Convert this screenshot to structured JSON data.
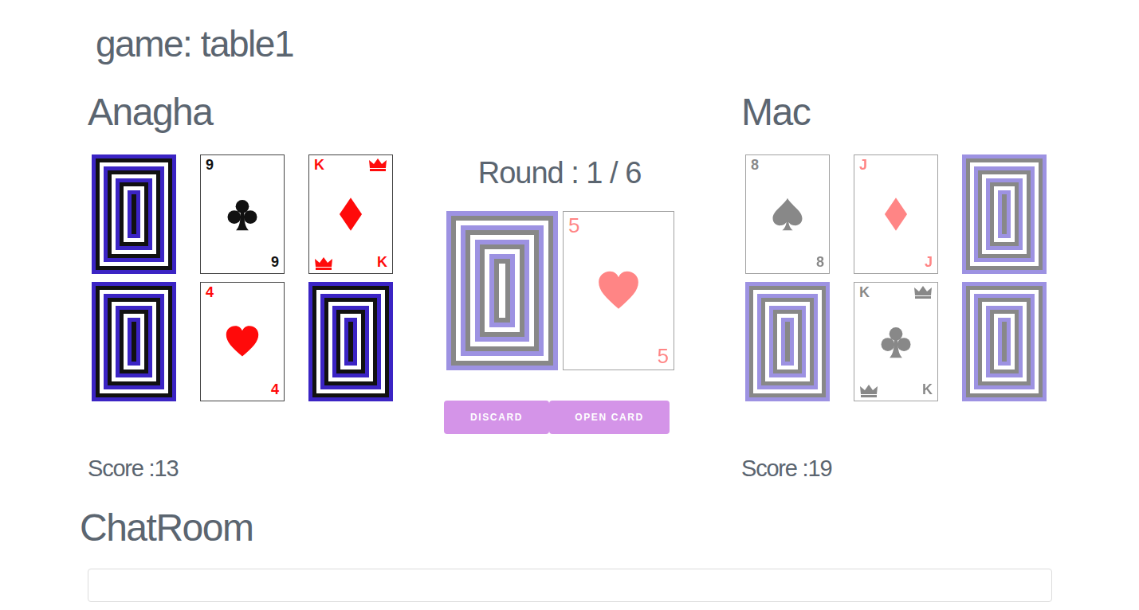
{
  "title": "game: table1",
  "round": "Round : 1 / 6",
  "players": [
    {
      "name": "Anagha",
      "active": true,
      "score": "Score :13",
      "cards": [
        {
          "kind": "back"
        },
        {
          "kind": "face",
          "rank": "9",
          "suit": "clubs"
        },
        {
          "kind": "face",
          "rank": "K",
          "suit": "diamonds"
        },
        {
          "kind": "back"
        },
        {
          "kind": "face",
          "rank": "4",
          "suit": "hearts"
        },
        {
          "kind": "back"
        }
      ]
    },
    {
      "name": "Mac",
      "active": false,
      "score": "Score :19",
      "cards": [
        {
          "kind": "face",
          "rank": "8",
          "suit": "spades"
        },
        {
          "kind": "face",
          "rank": "J",
          "suit": "diamonds"
        },
        {
          "kind": "back"
        },
        {
          "kind": "back"
        },
        {
          "kind": "face",
          "rank": "K",
          "suit": "clubs"
        },
        {
          "kind": "back"
        }
      ]
    }
  ],
  "pile": {
    "active": false,
    "deck": {
      "kind": "back"
    },
    "open": {
      "kind": "face",
      "rank": "5",
      "suit": "hearts"
    }
  },
  "buttons": [
    "DISCARD",
    "OPEN CARD"
  ],
  "chat": {
    "title": "ChatRoom",
    "input": {
      "placeholder": ""
    }
  }
}
